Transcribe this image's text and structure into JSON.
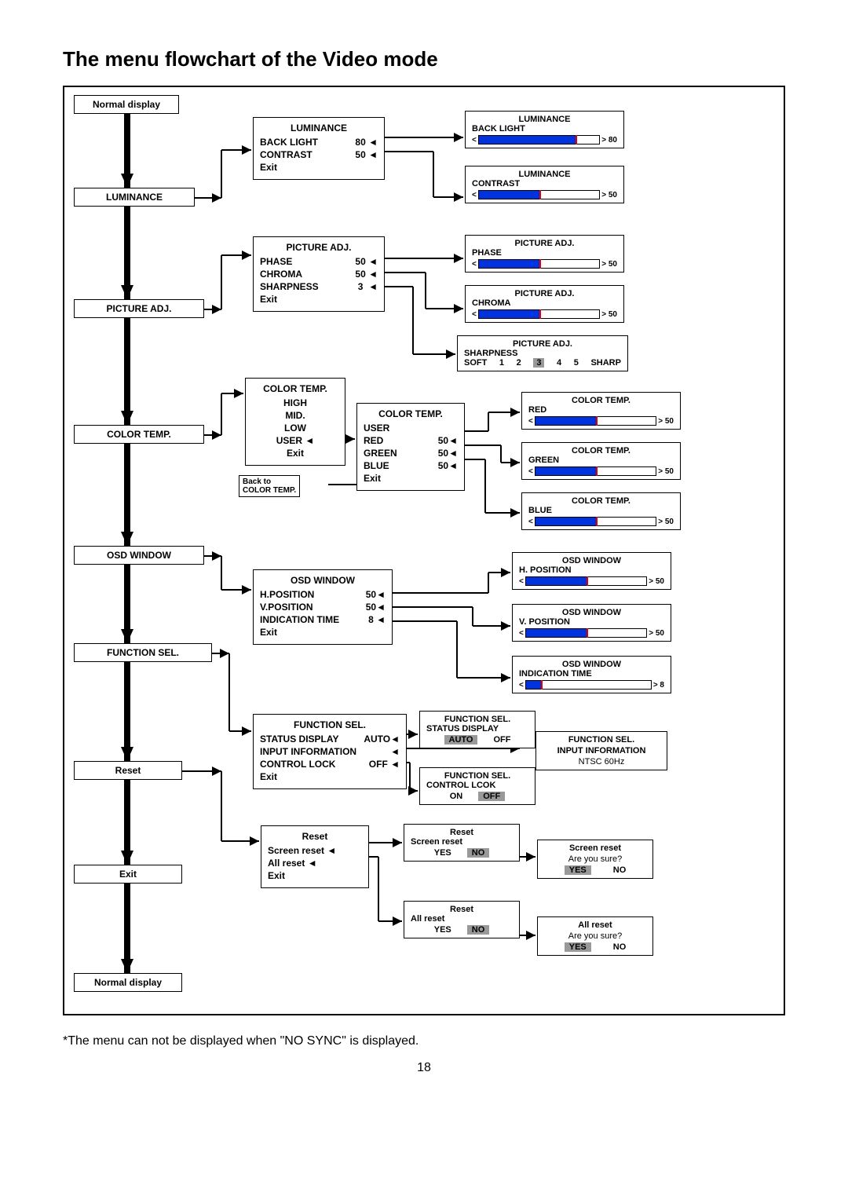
{
  "title": "The menu flowchart of the Video mode",
  "leftChain": {
    "start": "Normal display",
    "items": [
      "LUMINANCE",
      "PICTURE ADJ.",
      "COLOR TEMP.",
      "OSD WINDOW",
      "FUNCTION SEL.",
      "Reset",
      "Exit"
    ],
    "end": "Normal display"
  },
  "luminance": {
    "header": "LUMINANCE",
    "backlight_label": "BACK LIGHT",
    "backlight_val": "80",
    "contrast_label": "CONTRAST",
    "contrast_val": "50",
    "exit": "Exit",
    "g_backlight": {
      "title": "LUMINANCE",
      "sub": "BACK LIGHT",
      "val": "> 80"
    },
    "g_contrast": {
      "title": "LUMINANCE",
      "sub": "CONTRAST",
      "val": "> 50"
    }
  },
  "picture": {
    "header": "PICTURE ADJ.",
    "phase_label": "PHASE",
    "phase_val": "50",
    "chroma_label": "CHROMA",
    "chroma_val": "50",
    "sharp_label": "SHARPNESS",
    "sharp_val": "3",
    "exit": "Exit",
    "g_phase": {
      "title": "PICTURE ADJ.",
      "sub": "PHASE",
      "val": "> 50"
    },
    "g_chroma": {
      "title": "PICTURE ADJ.",
      "sub": "CHROMA",
      "val": "> 50"
    },
    "g_sharp": {
      "title": "PICTURE ADJ.",
      "sub": "SHARPNESS",
      "scale_left": "SOFT",
      "s1": "1",
      "s2": "2",
      "s3": "3",
      "s4": "4",
      "s5": "5",
      "scale_right": "SHARP"
    }
  },
  "colortemp": {
    "header": "COLOR TEMP.",
    "high": "HIGH",
    "mid": "MID.",
    "low": "LOW",
    "user": "USER",
    "exit": "Exit",
    "usermenu": {
      "header": "COLOR TEMP.",
      "sub": "USER",
      "red_label": "RED",
      "red_val": "50",
      "green_label": "GREEN",
      "green_val": "50",
      "blue_label": "BLUE",
      "blue_val": "50",
      "exit": "Exit"
    },
    "back_label_1": "Back to",
    "back_label_2": "COLOR TEMP.",
    "g_red": {
      "title": "COLOR TEMP.",
      "sub": "RED",
      "val": "> 50"
    },
    "g_green": {
      "title": "COLOR TEMP.",
      "sub": "GREEN",
      "val": "> 50"
    },
    "g_blue": {
      "title": "COLOR TEMP.",
      "sub": "BLUE",
      "val": "> 50"
    }
  },
  "osd": {
    "header": "OSD WINDOW",
    "hpos_label": "H.POSITION",
    "hpos_val": "50",
    "vpos_label": "V.POSITION",
    "vpos_val": "50",
    "ind_label": "INDICATION TIME",
    "ind_val": "8",
    "exit": "Exit",
    "g_h": {
      "title": "OSD WINDOW",
      "sub": "H. POSITION",
      "val": "> 50"
    },
    "g_v": {
      "title": "OSD WINDOW",
      "sub": "V. POSITION",
      "val": "> 50"
    },
    "g_i": {
      "title": "OSD WINDOW",
      "sub": "INDICATION TIME",
      "val": "> 8"
    }
  },
  "func": {
    "header": "FUNCTION SEL.",
    "status_label": "STATUS DISPLAY",
    "status_val": "AUTO",
    "input_label": "INPUT INFORMATION",
    "lock_label": "CONTROL LOCK",
    "lock_val": "OFF",
    "exit": "Exit",
    "opt_status": {
      "title": "FUNCTION SEL.",
      "sub": "STATUS DISPLAY",
      "o1": "AUTO",
      "o2": "OFF"
    },
    "opt_lock": {
      "title": "FUNCTION SEL.",
      "sub": "CONTROL LCOK",
      "o1": "ON",
      "o2": "OFF"
    },
    "input_info": {
      "title": "FUNCTION SEL.",
      "sub": "INPUT INFORMATION",
      "val": "NTSC 60Hz"
    }
  },
  "reset": {
    "header": "Reset",
    "screen": "Screen reset",
    "all": "All reset",
    "exit": "Exit",
    "scr_conf": {
      "title": "Reset",
      "sub": "Screen reset",
      "yes": "YES",
      "no": "NO"
    },
    "all_conf": {
      "title": "Reset",
      "sub": "All reset",
      "yes": "YES",
      "no": "NO"
    },
    "scr_sure": {
      "t": "Screen reset",
      "q": "Are you sure?",
      "yes": "YES",
      "no": "NO"
    },
    "all_sure": {
      "t": "All reset",
      "q": "Are you sure?",
      "yes": "YES",
      "no": "NO"
    }
  },
  "footnote": "*The menu can not be displayed when \"NO SYNC\" is displayed.",
  "page": "18"
}
